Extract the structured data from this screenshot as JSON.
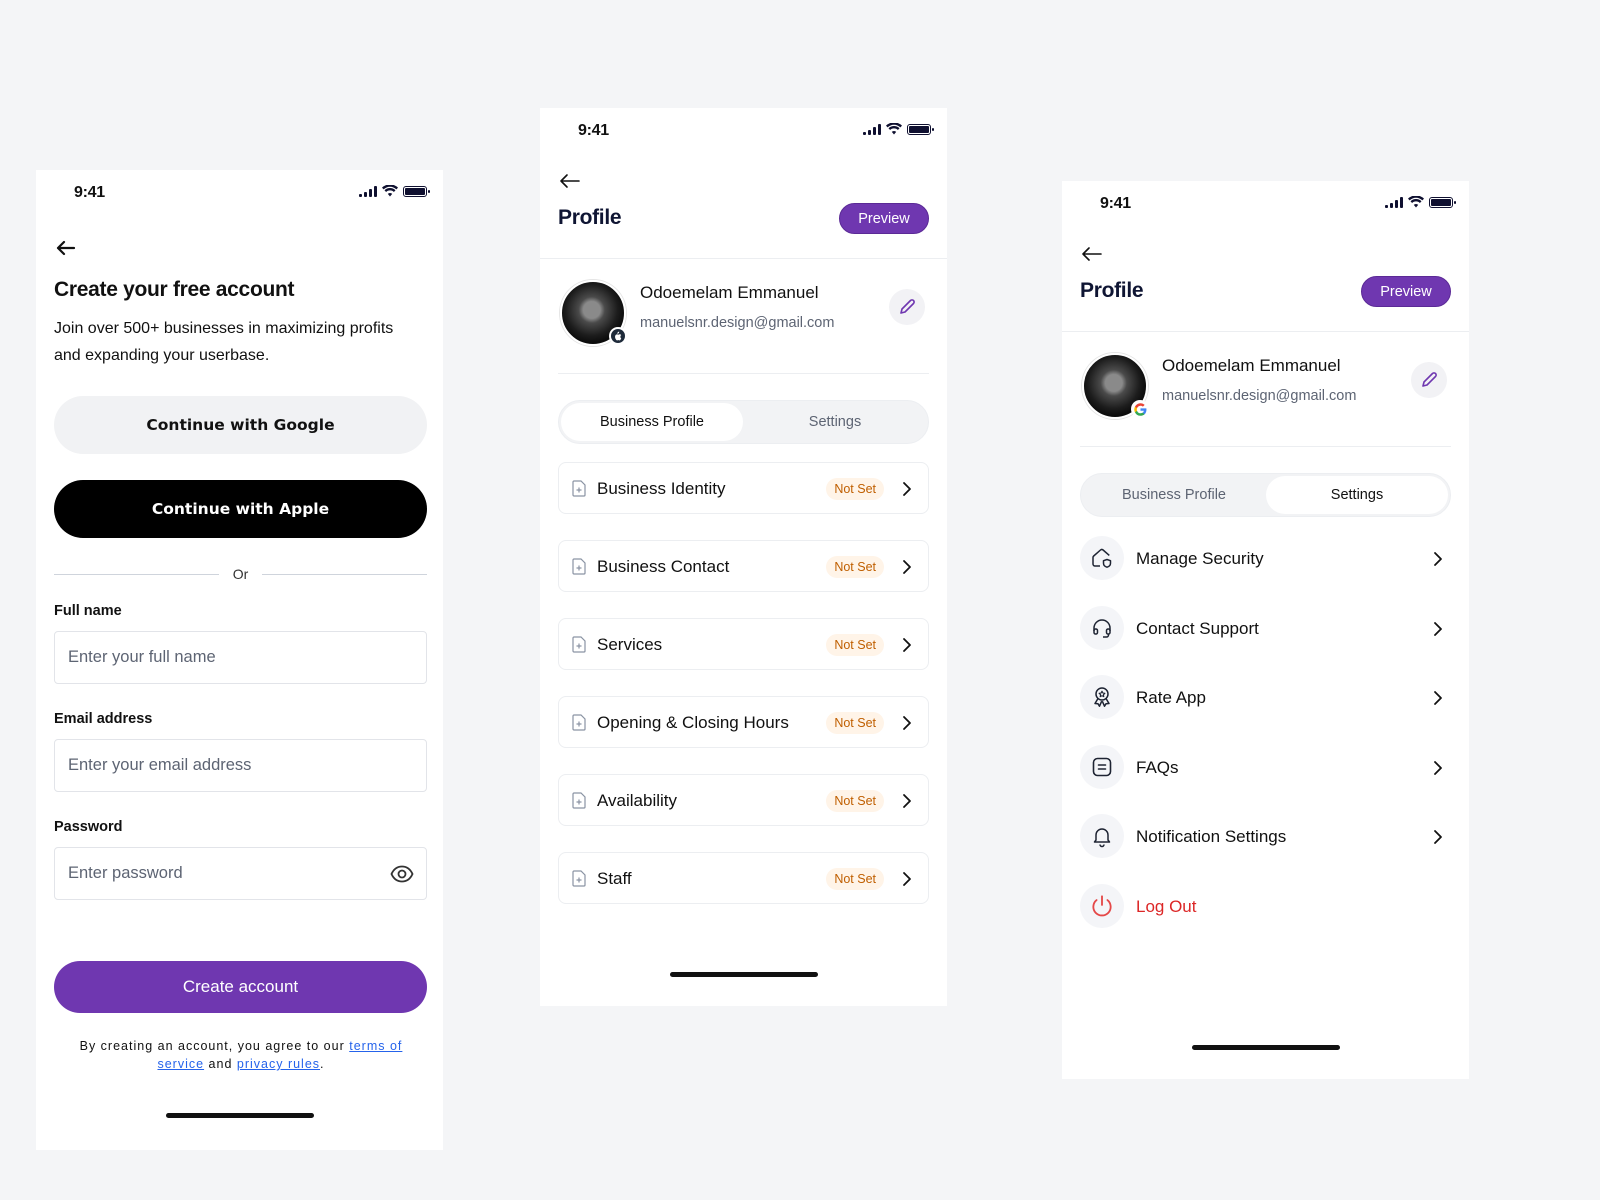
{
  "status_bar": {
    "time": "9:41"
  },
  "signup": {
    "title": "Create your free account",
    "subtitle": "Join over 500+ businesses in maximizing profits and expanding your userbase.",
    "google_button": "Continue with Google",
    "apple_button": "Continue with Apple",
    "divider_text": "Or",
    "fields": [
      {
        "label": "Full name",
        "placeholder": "Enter your full name",
        "value": ""
      },
      {
        "label": "Email address",
        "placeholder": "Enter your email address",
        "value": ""
      },
      {
        "label": "Password",
        "placeholder": "Enter password",
        "value": ""
      }
    ],
    "create_button": "Create account",
    "legal": {
      "prefix": "By creating an account, you agree to our ",
      "terms_link": "terms of service",
      "middle": " and ",
      "privacy_link": "privacy rules",
      "suffix": "."
    }
  },
  "profile": {
    "title": "Profile",
    "preview_button": "Preview",
    "user": {
      "name": "Odoemelam Emmanuel",
      "email": "manuelsnr.design@gmail.com"
    },
    "tabs": [
      {
        "label": "Business Profile"
      },
      {
        "label": "Settings"
      }
    ],
    "business_items": [
      {
        "label": "Business Identity",
        "status": "Not Set"
      },
      {
        "label": "Business Contact",
        "status": "Not Set"
      },
      {
        "label": "Services",
        "status": "Not Set"
      },
      {
        "label": "Opening & Closing Hours",
        "status": "Not Set"
      },
      {
        "label": "Availability",
        "status": "Not Set"
      },
      {
        "label": "Staff",
        "status": "Not Set"
      }
    ],
    "settings_items": [
      {
        "label": "Manage Security",
        "icon": "shield-home-icon"
      },
      {
        "label": "Contact Support",
        "icon": "headset-icon"
      },
      {
        "label": "Rate App",
        "icon": "award-badge-icon"
      },
      {
        "label": "FAQs",
        "icon": "faq-icon"
      },
      {
        "label": "Notification Settings",
        "icon": "bell-icon"
      },
      {
        "label": "Log Out",
        "icon": "power-icon"
      }
    ]
  },
  "colors": {
    "accent": "#6f37b0",
    "warning_text": "#c05f00",
    "warning_bg": "#fff4e8",
    "danger": "#dc2626",
    "title": "#0f1533"
  }
}
